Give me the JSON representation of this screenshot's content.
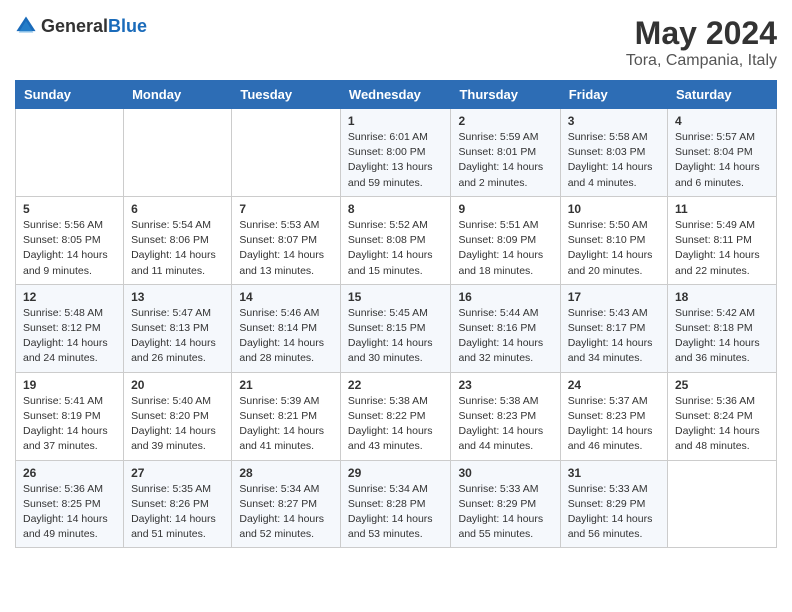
{
  "header": {
    "logo_general": "General",
    "logo_blue": "Blue",
    "month": "May 2024",
    "location": "Tora, Campania, Italy"
  },
  "weekdays": [
    "Sunday",
    "Monday",
    "Tuesday",
    "Wednesday",
    "Thursday",
    "Friday",
    "Saturday"
  ],
  "weeks": [
    [
      {
        "day": "",
        "info": ""
      },
      {
        "day": "",
        "info": ""
      },
      {
        "day": "",
        "info": ""
      },
      {
        "day": "1",
        "info": "Sunrise: 6:01 AM\nSunset: 8:00 PM\nDaylight: 13 hours\nand 59 minutes."
      },
      {
        "day": "2",
        "info": "Sunrise: 5:59 AM\nSunset: 8:01 PM\nDaylight: 14 hours\nand 2 minutes."
      },
      {
        "day": "3",
        "info": "Sunrise: 5:58 AM\nSunset: 8:03 PM\nDaylight: 14 hours\nand 4 minutes."
      },
      {
        "day": "4",
        "info": "Sunrise: 5:57 AM\nSunset: 8:04 PM\nDaylight: 14 hours\nand 6 minutes."
      }
    ],
    [
      {
        "day": "5",
        "info": "Sunrise: 5:56 AM\nSunset: 8:05 PM\nDaylight: 14 hours\nand 9 minutes."
      },
      {
        "day": "6",
        "info": "Sunrise: 5:54 AM\nSunset: 8:06 PM\nDaylight: 14 hours\nand 11 minutes."
      },
      {
        "day": "7",
        "info": "Sunrise: 5:53 AM\nSunset: 8:07 PM\nDaylight: 14 hours\nand 13 minutes."
      },
      {
        "day": "8",
        "info": "Sunrise: 5:52 AM\nSunset: 8:08 PM\nDaylight: 14 hours\nand 15 minutes."
      },
      {
        "day": "9",
        "info": "Sunrise: 5:51 AM\nSunset: 8:09 PM\nDaylight: 14 hours\nand 18 minutes."
      },
      {
        "day": "10",
        "info": "Sunrise: 5:50 AM\nSunset: 8:10 PM\nDaylight: 14 hours\nand 20 minutes."
      },
      {
        "day": "11",
        "info": "Sunrise: 5:49 AM\nSunset: 8:11 PM\nDaylight: 14 hours\nand 22 minutes."
      }
    ],
    [
      {
        "day": "12",
        "info": "Sunrise: 5:48 AM\nSunset: 8:12 PM\nDaylight: 14 hours\nand 24 minutes."
      },
      {
        "day": "13",
        "info": "Sunrise: 5:47 AM\nSunset: 8:13 PM\nDaylight: 14 hours\nand 26 minutes."
      },
      {
        "day": "14",
        "info": "Sunrise: 5:46 AM\nSunset: 8:14 PM\nDaylight: 14 hours\nand 28 minutes."
      },
      {
        "day": "15",
        "info": "Sunrise: 5:45 AM\nSunset: 8:15 PM\nDaylight: 14 hours\nand 30 minutes."
      },
      {
        "day": "16",
        "info": "Sunrise: 5:44 AM\nSunset: 8:16 PM\nDaylight: 14 hours\nand 32 minutes."
      },
      {
        "day": "17",
        "info": "Sunrise: 5:43 AM\nSunset: 8:17 PM\nDaylight: 14 hours\nand 34 minutes."
      },
      {
        "day": "18",
        "info": "Sunrise: 5:42 AM\nSunset: 8:18 PM\nDaylight: 14 hours\nand 36 minutes."
      }
    ],
    [
      {
        "day": "19",
        "info": "Sunrise: 5:41 AM\nSunset: 8:19 PM\nDaylight: 14 hours\nand 37 minutes."
      },
      {
        "day": "20",
        "info": "Sunrise: 5:40 AM\nSunset: 8:20 PM\nDaylight: 14 hours\nand 39 minutes."
      },
      {
        "day": "21",
        "info": "Sunrise: 5:39 AM\nSunset: 8:21 PM\nDaylight: 14 hours\nand 41 minutes."
      },
      {
        "day": "22",
        "info": "Sunrise: 5:38 AM\nSunset: 8:22 PM\nDaylight: 14 hours\nand 43 minutes."
      },
      {
        "day": "23",
        "info": "Sunrise: 5:38 AM\nSunset: 8:23 PM\nDaylight: 14 hours\nand 44 minutes."
      },
      {
        "day": "24",
        "info": "Sunrise: 5:37 AM\nSunset: 8:23 PM\nDaylight: 14 hours\nand 46 minutes."
      },
      {
        "day": "25",
        "info": "Sunrise: 5:36 AM\nSunset: 8:24 PM\nDaylight: 14 hours\nand 48 minutes."
      }
    ],
    [
      {
        "day": "26",
        "info": "Sunrise: 5:36 AM\nSunset: 8:25 PM\nDaylight: 14 hours\nand 49 minutes."
      },
      {
        "day": "27",
        "info": "Sunrise: 5:35 AM\nSunset: 8:26 PM\nDaylight: 14 hours\nand 51 minutes."
      },
      {
        "day": "28",
        "info": "Sunrise: 5:34 AM\nSunset: 8:27 PM\nDaylight: 14 hours\nand 52 minutes."
      },
      {
        "day": "29",
        "info": "Sunrise: 5:34 AM\nSunset: 8:28 PM\nDaylight: 14 hours\nand 53 minutes."
      },
      {
        "day": "30",
        "info": "Sunrise: 5:33 AM\nSunset: 8:29 PM\nDaylight: 14 hours\nand 55 minutes."
      },
      {
        "day": "31",
        "info": "Sunrise: 5:33 AM\nSunset: 8:29 PM\nDaylight: 14 hours\nand 56 minutes."
      },
      {
        "day": "",
        "info": ""
      }
    ]
  ]
}
